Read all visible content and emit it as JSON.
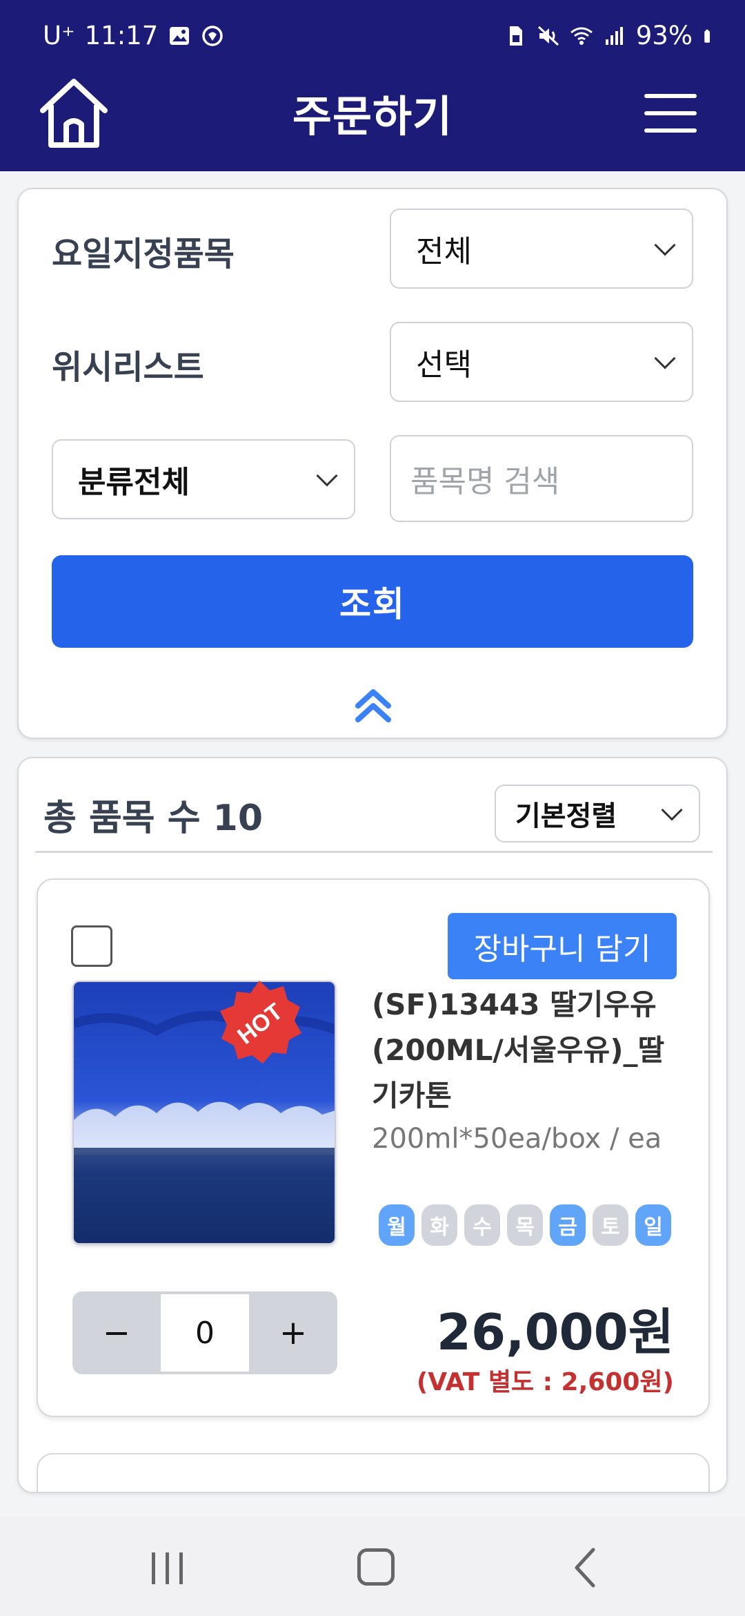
{
  "status_bar": {
    "carrier": "U⁺",
    "time": "11:17",
    "battery": "93%"
  },
  "app_bar": {
    "title": "주문하기"
  },
  "filters": {
    "weekday_label": "요일지정품목",
    "weekday_value": "전체",
    "wishlist_label": "위시리스트",
    "wishlist_value": "선택",
    "category_value": "분류전체",
    "search_placeholder": "품목명 검색",
    "search_button": "조회"
  },
  "list": {
    "total_label": "총 품목 수 10",
    "sort_value": "기본정렬"
  },
  "items": [
    {
      "badge": "HOT",
      "add_to_cart": "장바구니 담기",
      "name": "(SF)13443 딸기우유(200ML/서울우유)_딸기카톤",
      "spec": "200ml*50ea/box / ea",
      "days": [
        {
          "label": "월",
          "active": true
        },
        {
          "label": "화",
          "active": false
        },
        {
          "label": "수",
          "active": false
        },
        {
          "label": "목",
          "active": false
        },
        {
          "label": "금",
          "active": true
        },
        {
          "label": "토",
          "active": false
        },
        {
          "label": "일",
          "active": true
        }
      ],
      "quantity": "0",
      "minus": "−",
      "plus": "+",
      "price": "26,000원",
      "vat": "(VAT 별도 : 2,600원)"
    }
  ],
  "colors": {
    "header_bg": "#1c1c78",
    "primary": "#2563eb",
    "cart_button": "#3b82f6",
    "day_active": "#60a5fa",
    "day_inactive": "#d1d5db",
    "vat_text": "#c53030"
  }
}
